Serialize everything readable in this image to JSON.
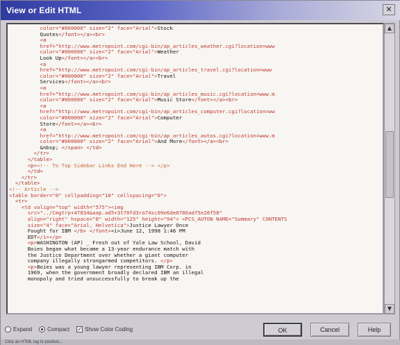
{
  "window": {
    "title": "View or Edit HTML",
    "close_glyph": "✕"
  },
  "editor": {
    "lines": [
      {
        "indent": "          ",
        "parts": [
          [
            "attr",
            "color=\"#000000\" size=\"2\" face=\"Arial\">"
          ],
          [
            "text",
            "Stock"
          ]
        ]
      },
      {
        "indent": "          ",
        "parts": [
          [
            "text",
            "Quotes"
          ],
          [
            "tag",
            "</font></a><br>"
          ]
        ]
      },
      {
        "indent": "          ",
        "parts": [
          [
            "tag",
            "<a"
          ]
        ]
      },
      {
        "indent": "          ",
        "parts": [
          [
            "attr",
            "href=\"http://www.metropoint.com/cgi-bin/ap_articles_weather.cgi?location=www"
          ]
        ]
      },
      {
        "indent": "          ",
        "parts": [
          [
            "attr",
            "color=\"#000000\" size=\"2\" face=\"Arial\">"
          ],
          [
            "text",
            "Weather"
          ]
        ]
      },
      {
        "indent": "          ",
        "parts": [
          [
            "text",
            "Look Up"
          ],
          [
            "tag",
            "</font></a><br>"
          ]
        ]
      },
      {
        "indent": "          ",
        "parts": [
          [
            "tag",
            "<a"
          ]
        ]
      },
      {
        "indent": "          ",
        "parts": [
          [
            "attr",
            "href=\"http://www.metropoint.com/cgi-bin/ap_articles_travel.cgi?location=www"
          ]
        ]
      },
      {
        "indent": "          ",
        "parts": [
          [
            "attr",
            "color=\"#000000\" size=\"2\" face=\"Arial\">"
          ],
          [
            "text",
            "Travel"
          ]
        ]
      },
      {
        "indent": "          ",
        "parts": [
          [
            "text",
            "Services"
          ],
          [
            "tag",
            "</font></a><br>"
          ]
        ]
      },
      {
        "indent": "          ",
        "parts": [
          [
            "tag",
            "<a"
          ]
        ]
      },
      {
        "indent": "          ",
        "parts": [
          [
            "attr",
            "href=\"http://www.metropoint.com/cgi-bin/ap_articles_music.cgi?location=www.m"
          ]
        ]
      },
      {
        "indent": "          ",
        "parts": [
          [
            "attr",
            "color=\"#000000\" size=\"2\" face=\"Arial\">"
          ],
          [
            "text",
            "Music Store"
          ],
          [
            "tag",
            "</font></a><br>"
          ]
        ]
      },
      {
        "indent": "          ",
        "parts": [
          [
            "tag",
            "<a"
          ]
        ]
      },
      {
        "indent": "          ",
        "parts": [
          [
            "attr",
            "href=\"http://www.metropoint.com/cgi-bin/ap_articles_computer.cgi?location=ww"
          ]
        ]
      },
      {
        "indent": "          ",
        "parts": [
          [
            "attr",
            "color=\"#000000\" size=\"2\" face=\"Arial\">"
          ],
          [
            "text",
            "Computer"
          ]
        ]
      },
      {
        "indent": "          ",
        "parts": [
          [
            "text",
            "Store"
          ],
          [
            "tag",
            "</font></a><br>"
          ]
        ]
      },
      {
        "indent": "          ",
        "parts": [
          [
            "tag",
            "<a"
          ]
        ]
      },
      {
        "indent": "          ",
        "parts": [
          [
            "attr",
            "href=\"http://www.metropoint.com/cgi-bin/ap_articles_autos.cgi?location=www.m"
          ]
        ]
      },
      {
        "indent": "          ",
        "parts": [
          [
            "attr",
            "color=\"#000000\" size=\"2\" face=\"Arial\">"
          ],
          [
            "text",
            "And More"
          ],
          [
            "tag",
            "</font></a><br>"
          ]
        ]
      },
      {
        "indent": "          ",
        "parts": [
          [
            "text",
            "&nbsp; "
          ],
          [
            "tag",
            "</span> </td>"
          ]
        ]
      },
      {
        "indent": "        ",
        "parts": [
          [
            "tag",
            "</tr>"
          ]
        ]
      },
      {
        "indent": "      ",
        "parts": [
          [
            "tag",
            "</table>"
          ]
        ]
      },
      {
        "indent": "      ",
        "parts": [
          [
            "tag",
            "<p>"
          ],
          [
            "comment",
            "<!-- To Top Sidebar Links End Here --> </p>"
          ]
        ]
      },
      {
        "indent": "      ",
        "parts": [
          [
            "tag",
            "</td>"
          ]
        ]
      },
      {
        "indent": "    ",
        "parts": [
          [
            "tag",
            "</tr>"
          ]
        ]
      },
      {
        "indent": "  ",
        "parts": [
          [
            "tag",
            "</table>"
          ]
        ]
      },
      {
        "indent": "",
        "parts": [
          [
            "comment",
            "<!-- Article -->"
          ]
        ]
      },
      {
        "indent": "",
        "parts": [
          [
            "attr",
            "<table border=\"0\" cellpadding=\"10\" cellspacing=\"0\">"
          ]
        ]
      },
      {
        "indent": "  ",
        "parts": [
          [
            "tag",
            "<tr>"
          ]
        ]
      },
      {
        "indent": "    ",
        "parts": [
          [
            "attr",
            "<td valign=\"top\" width=\"575\"><img"
          ]
        ]
      },
      {
        "indent": "      ",
        "parts": [
          [
            "attr",
            "src=\"../Cmgtrp+47834&aap.ad5+3t70fd3ra74sc09e6de0786adf5e28f58\""
          ]
        ]
      },
      {
        "indent": "      ",
        "parts": [
          [
            "attr",
            "align=\"right\" hspace=\"8\" width=\"125\" height=\"94\"> <PCS_AUTON NAME=\"Summary\" CONTENTS"
          ]
        ]
      },
      {
        "indent": "      ",
        "parts": [
          [
            "attr",
            "size=\"4\" face=\"Arial, Helvetica\">"
          ],
          [
            "text",
            "Justice Lawyer Once"
          ]
        ]
      },
      {
        "indent": "      ",
        "parts": [
          [
            "text",
            "Fought for IBM "
          ],
          [
            "tag",
            "</b> </font>"
          ],
          [
            "text",
            "<i>June 12, 1998 1:46 PM"
          ]
        ]
      },
      {
        "indent": "      ",
        "parts": [
          [
            "text",
            "EDT"
          ],
          [
            "tag",
            "</i></p>"
          ]
        ]
      },
      {
        "indent": "      ",
        "parts": [
          [
            "tag",
            "<p>"
          ],
          [
            "text",
            "WASHINGTON (AP) _ Fresh out of Yale Law School, David"
          ]
        ]
      },
      {
        "indent": "      ",
        "parts": [
          [
            "text",
            "Boies began what became a 13-year endurance match with"
          ]
        ]
      },
      {
        "indent": "      ",
        "parts": [
          [
            "text",
            "the Justice Department over whether a giant computer"
          ]
        ]
      },
      {
        "indent": "      ",
        "parts": [
          [
            "text",
            "company illegally strongarmed competitors. "
          ],
          [
            "tag",
            "</p>"
          ]
        ]
      },
      {
        "indent": "      ",
        "parts": [
          [
            "tag",
            "<p>"
          ],
          [
            "text",
            "Boies was a young lawyer representing IBM Corp. in"
          ]
        ]
      },
      {
        "indent": "      ",
        "parts": [
          [
            "text",
            "1969, when the government broadly declared IBM an illegal"
          ]
        ]
      },
      {
        "indent": "      ",
        "parts": [
          [
            "text",
            "monopoly and tried unsuccessfully to break up the"
          ]
        ]
      }
    ]
  },
  "options": {
    "expand_label": "Expand",
    "compact_label": "Compact",
    "show_color_coding_label": "Show Color Coding",
    "check_glyph": "✓"
  },
  "buttons": {
    "ok_label": "OK",
    "cancel_label": "Cancel",
    "help_label": "Help"
  },
  "scroll": {
    "up_glyph": "▲",
    "down_glyph": "▼",
    "position": 0.48
  },
  "status": {
    "text": "Click an HTML tag to position..."
  },
  "colors": {
    "titlebar_start": "#2f3aa0",
    "tag": "#b3322a",
    "comment": "#c7612c"
  }
}
